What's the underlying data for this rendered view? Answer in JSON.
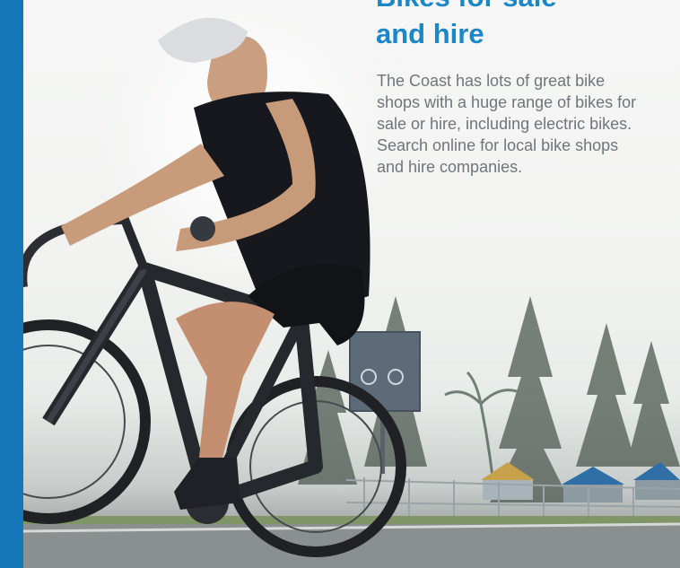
{
  "article": {
    "title": "Bikes for sale\nand hire",
    "body": "The Coast has lots of great bike shops with a huge range of bikes for sale or hire, including electric bikes. Search online for local bike shops and hire companies."
  },
  "colors": {
    "accent_bar": "#1677b8",
    "title": "#1b86c8",
    "body_text": "#6f757a"
  }
}
